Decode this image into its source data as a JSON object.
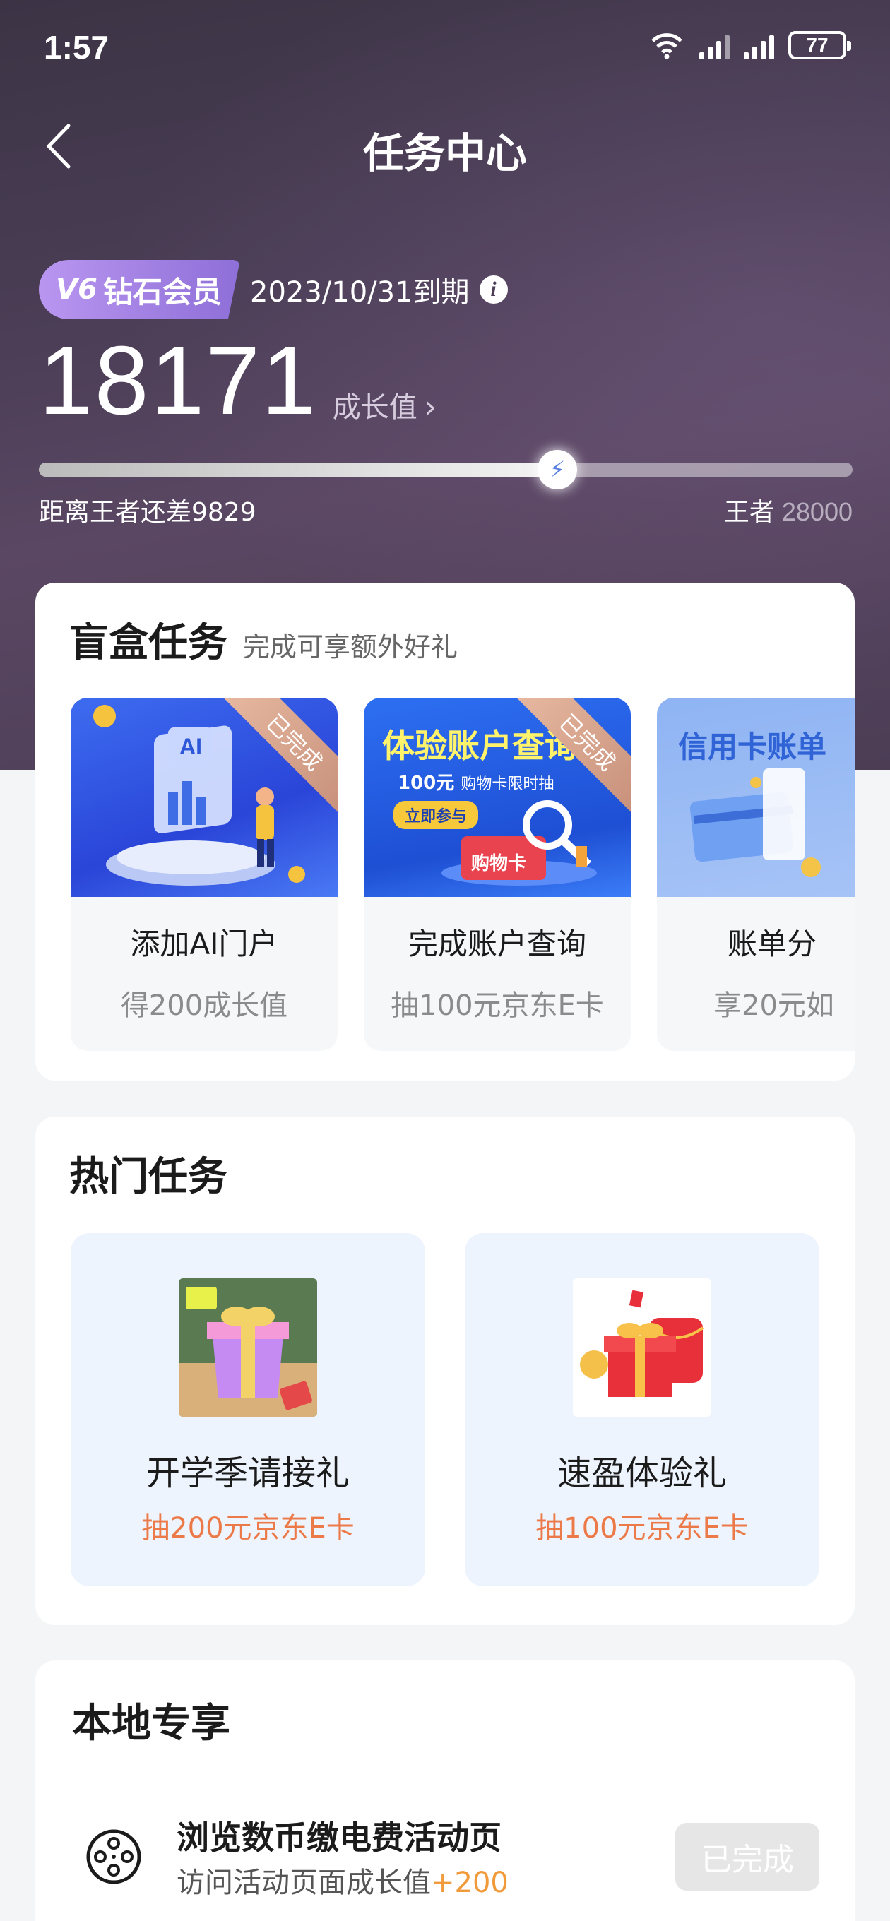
{
  "status_bar": {
    "time": "1:57",
    "battery": "77"
  },
  "nav": {
    "title": "任务中心"
  },
  "member": {
    "level": "6",
    "tier": "钻石会员",
    "expire": "2023/10/31到期"
  },
  "growth": {
    "value": "18171",
    "label": "成长值",
    "progress": 0.637,
    "remaining": "距离王者还差9829",
    "next_tier": "王者",
    "next_tier_value": "28000"
  },
  "blind_box": {
    "title": "盲盒任务",
    "subtitle": "完成可享额外好礼",
    "items": [
      {
        "name": "添加AI门户",
        "reward": "得200成长值",
        "status": "已完成",
        "banner_text": "AI"
      },
      {
        "name": "完成账户查询",
        "reward": "抽100元京东E卡",
        "status": "已完成",
        "banner_title": "体验账户查询",
        "banner_line": "100元",
        "banner_line2": "购物卡限时抽",
        "banner_cta": "立即参与",
        "banner_card": "购物卡"
      },
      {
        "name": "账单分",
        "reward": "享20元如",
        "banner_title": "信用卡账单"
      }
    ]
  },
  "hot": {
    "title": "热门任务",
    "items": [
      {
        "name": "开学季请接礼",
        "reward": "抽200元京东E卡"
      },
      {
        "name": "速盈体验礼",
        "reward": "抽100元京东E卡"
      }
    ]
  },
  "local": {
    "title": "本地专享",
    "task_title": "浏览数币缴电费活动页",
    "task_sub": "访问活动页面成长值",
    "task_plus": "+200",
    "button": "已完成"
  },
  "colors": {
    "accent_orange": "#ec7a49",
    "hero_bg": "#4a3d55",
    "badge_purple": "#a886e6"
  }
}
